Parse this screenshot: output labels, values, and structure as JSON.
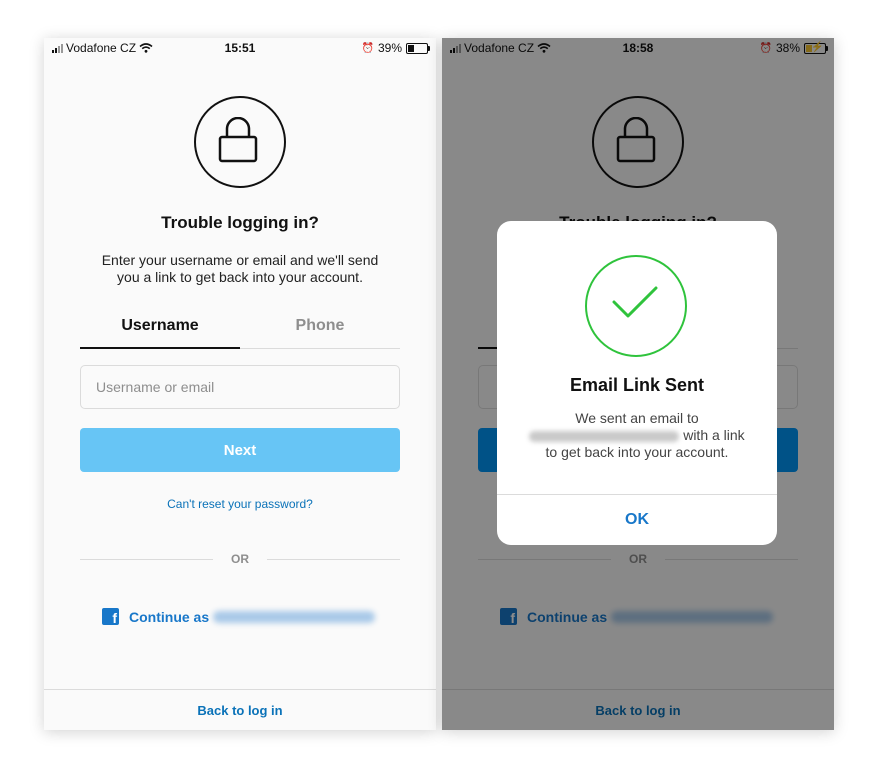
{
  "left_screen": {
    "status": {
      "carrier": "Vodafone CZ",
      "time": "15:51",
      "battery": "39%",
      "battery_level": 0.39
    },
    "title": "Trouble logging in?",
    "description": "Enter your username or email and we'll send you a link to get back into your account.",
    "tabs": [
      {
        "label": "Username",
        "active": true
      },
      {
        "label": "Phone",
        "active": false
      }
    ],
    "input_placeholder": "Username or email",
    "next_label": "Next",
    "reset_link": "Can't reset your password?",
    "divider_text": "OR",
    "facebook_label": "Continue as",
    "back_link": "Back to log in"
  },
  "right_screen": {
    "status": {
      "carrier": "Vodafone CZ",
      "time": "18:58",
      "battery": "38%",
      "battery_level": 0.38,
      "charging": true
    },
    "background": {
      "title": "Trouble logging in?",
      "divider_text": "OR",
      "facebook_label": "Continue as",
      "back_link": "Back to log in"
    },
    "dialog": {
      "title": "Email Link Sent",
      "message_before": "We sent an email to",
      "message_after": "with a link to get back into your account.",
      "ok_label": "OK"
    }
  },
  "colors": {
    "link_blue": "#0a72b8",
    "button_disabled_blue": "#67c5f5",
    "facebook_blue": "#1877c9",
    "success_green": "#2fc33c"
  },
  "icons": [
    "lock-icon",
    "checkmark-icon",
    "facebook-icon",
    "wifi-icon",
    "alarm-icon",
    "signal-icon",
    "battery-icon"
  ]
}
